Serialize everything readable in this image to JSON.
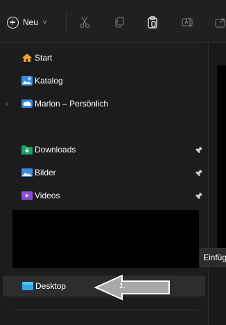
{
  "toolbar": {
    "new_label": "Neu",
    "new_chevron": "˅",
    "icons": [
      "cut-icon",
      "copy-icon",
      "paste-icon",
      "rename-icon",
      "share-icon"
    ]
  },
  "sidebar": {
    "home": {
      "label": "Start",
      "icon": "home-icon"
    },
    "gallery": {
      "label": "Katalog",
      "icon": "gallery-icon"
    },
    "cloud": {
      "label": "Marlon – Persönlich",
      "icon": "onedrive-icon",
      "chevron": "›"
    },
    "quick_access": [
      {
        "label": "Downloads",
        "icon": "downloads-folder-icon",
        "pinned": true
      },
      {
        "label": "Bilder",
        "icon": "pictures-folder-icon",
        "pinned": true
      },
      {
        "label": "Videos",
        "icon": "videos-folder-icon",
        "pinned": true
      }
    ],
    "desktop": {
      "label": "Desktop",
      "icon": "desktop-folder-icon"
    }
  },
  "tooltip": {
    "text": "Einfüg"
  },
  "annotation": {
    "step_label": "1."
  },
  "colors": {
    "background": "#1c1c1c",
    "toolbar": "#202020",
    "selected_row": "#2d2d2d",
    "home_icon": "#f0a030",
    "gallery_icon": "#3a8fe0",
    "onedrive_icon": "#2f8be6",
    "downloads_icon": "#1fa36a",
    "pictures_icon": "#3d8ee0",
    "videos_icon": "#8a4fd8",
    "desktop_icon": "#2ea7e8",
    "arrow_fill": "#b0b0b0"
  }
}
